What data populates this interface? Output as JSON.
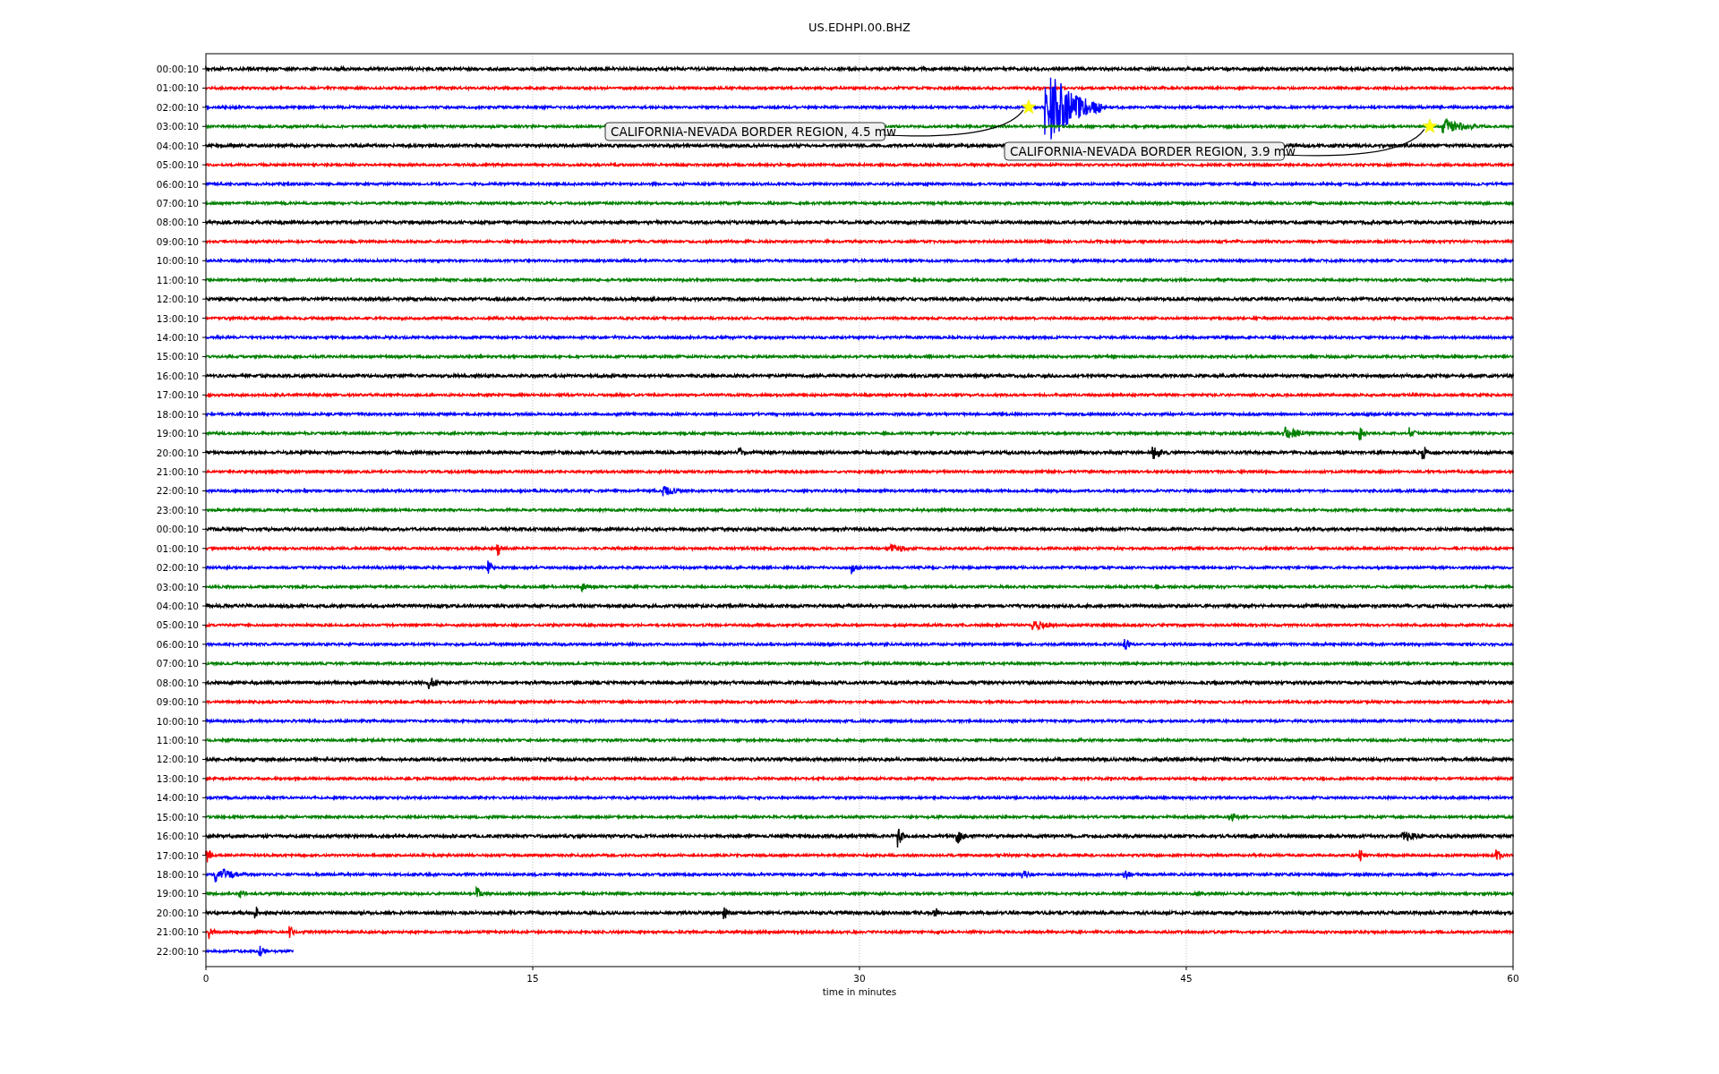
{
  "title": "US.EDHPI.00.BHZ",
  "chart": {
    "xlabel": "time in minutes",
    "xticks": [
      "0",
      "15",
      "30",
      "45",
      "60"
    ],
    "rows": [
      {
        "label": "00:00:10",
        "color": "#000000",
        "complete": true
      },
      {
        "label": "01:00:10",
        "color": "#ff0000",
        "complete": true
      },
      {
        "label": "02:00:10",
        "color": "#0000ff",
        "complete": true
      },
      {
        "label": "03:00:10",
        "color": "#008000",
        "complete": true
      },
      {
        "label": "04:00:10",
        "color": "#000000",
        "complete": true
      },
      {
        "label": "05:00:10",
        "color": "#ff0000",
        "complete": true
      },
      {
        "label": "06:00:10",
        "color": "#0000ff",
        "complete": true
      },
      {
        "label": "07:00:10",
        "color": "#008000",
        "complete": true
      },
      {
        "label": "08:00:10",
        "color": "#000000",
        "complete": true
      },
      {
        "label": "09:00:10",
        "color": "#ff0000",
        "complete": true
      },
      {
        "label": "10:00:10",
        "color": "#0000ff",
        "complete": true
      },
      {
        "label": "11:00:10",
        "color": "#008000",
        "complete": true
      },
      {
        "label": "12:00:10",
        "color": "#000000",
        "complete": true
      },
      {
        "label": "13:00:10",
        "color": "#ff0000",
        "complete": true
      },
      {
        "label": "14:00:10",
        "color": "#0000ff",
        "complete": true
      },
      {
        "label": "15:00:10",
        "color": "#008000",
        "complete": true
      },
      {
        "label": "16:00:10",
        "color": "#000000",
        "complete": true
      },
      {
        "label": "17:00:10",
        "color": "#ff0000",
        "complete": true
      },
      {
        "label": "18:00:10",
        "color": "#0000ff",
        "complete": true
      },
      {
        "label": "19:00:10",
        "color": "#008000",
        "complete": true
      },
      {
        "label": "20:00:10",
        "color": "#000000",
        "complete": true
      },
      {
        "label": "21:00:10",
        "color": "#ff0000",
        "complete": true
      },
      {
        "label": "22:00:10",
        "color": "#0000ff",
        "complete": true
      },
      {
        "label": "23:00:10",
        "color": "#008000",
        "complete": true
      },
      {
        "label": "00:00:10",
        "color": "#000000",
        "complete": true
      },
      {
        "label": "01:00:10",
        "color": "#ff0000",
        "complete": true
      },
      {
        "label": "02:00:10",
        "color": "#0000ff",
        "complete": true
      },
      {
        "label": "03:00:10",
        "color": "#008000",
        "complete": true
      },
      {
        "label": "04:00:10",
        "color": "#000000",
        "complete": true
      },
      {
        "label": "05:00:10",
        "color": "#ff0000",
        "complete": true
      },
      {
        "label": "06:00:10",
        "color": "#0000ff",
        "complete": true
      },
      {
        "label": "07:00:10",
        "color": "#008000",
        "complete": true
      },
      {
        "label": "08:00:10",
        "color": "#000000",
        "complete": true
      },
      {
        "label": "09:00:10",
        "color": "#ff0000",
        "complete": true
      },
      {
        "label": "10:00:10",
        "color": "#0000ff",
        "complete": true
      },
      {
        "label": "11:00:10",
        "color": "#008000",
        "complete": true
      },
      {
        "label": "12:00:10",
        "color": "#000000",
        "complete": true
      },
      {
        "label": "13:00:10",
        "color": "#ff0000",
        "complete": true
      },
      {
        "label": "14:00:10",
        "color": "#0000ff",
        "complete": true
      },
      {
        "label": "15:00:10",
        "color": "#008000",
        "complete": true
      },
      {
        "label": "16:00:10",
        "color": "#000000",
        "complete": true
      },
      {
        "label": "17:00:10",
        "color": "#ff0000",
        "complete": true
      },
      {
        "label": "18:00:10",
        "color": "#0000ff",
        "complete": true
      },
      {
        "label": "19:00:10",
        "color": "#008000",
        "complete": true
      },
      {
        "label": "20:00:10",
        "color": "#000000",
        "complete": true
      },
      {
        "label": "21:00:10",
        "color": "#ff0000",
        "complete": true
      },
      {
        "label": "22:00:10",
        "color": "#0000ff",
        "complete": false
      }
    ],
    "annotations": [
      {
        "text": "CALIFORNIA-NEVADA BORDER REGION, 4.5 mw"
      },
      {
        "text": "CALIFORNIA-NEVADA BORDER REGION, 3.9 mw"
      }
    ]
  }
}
